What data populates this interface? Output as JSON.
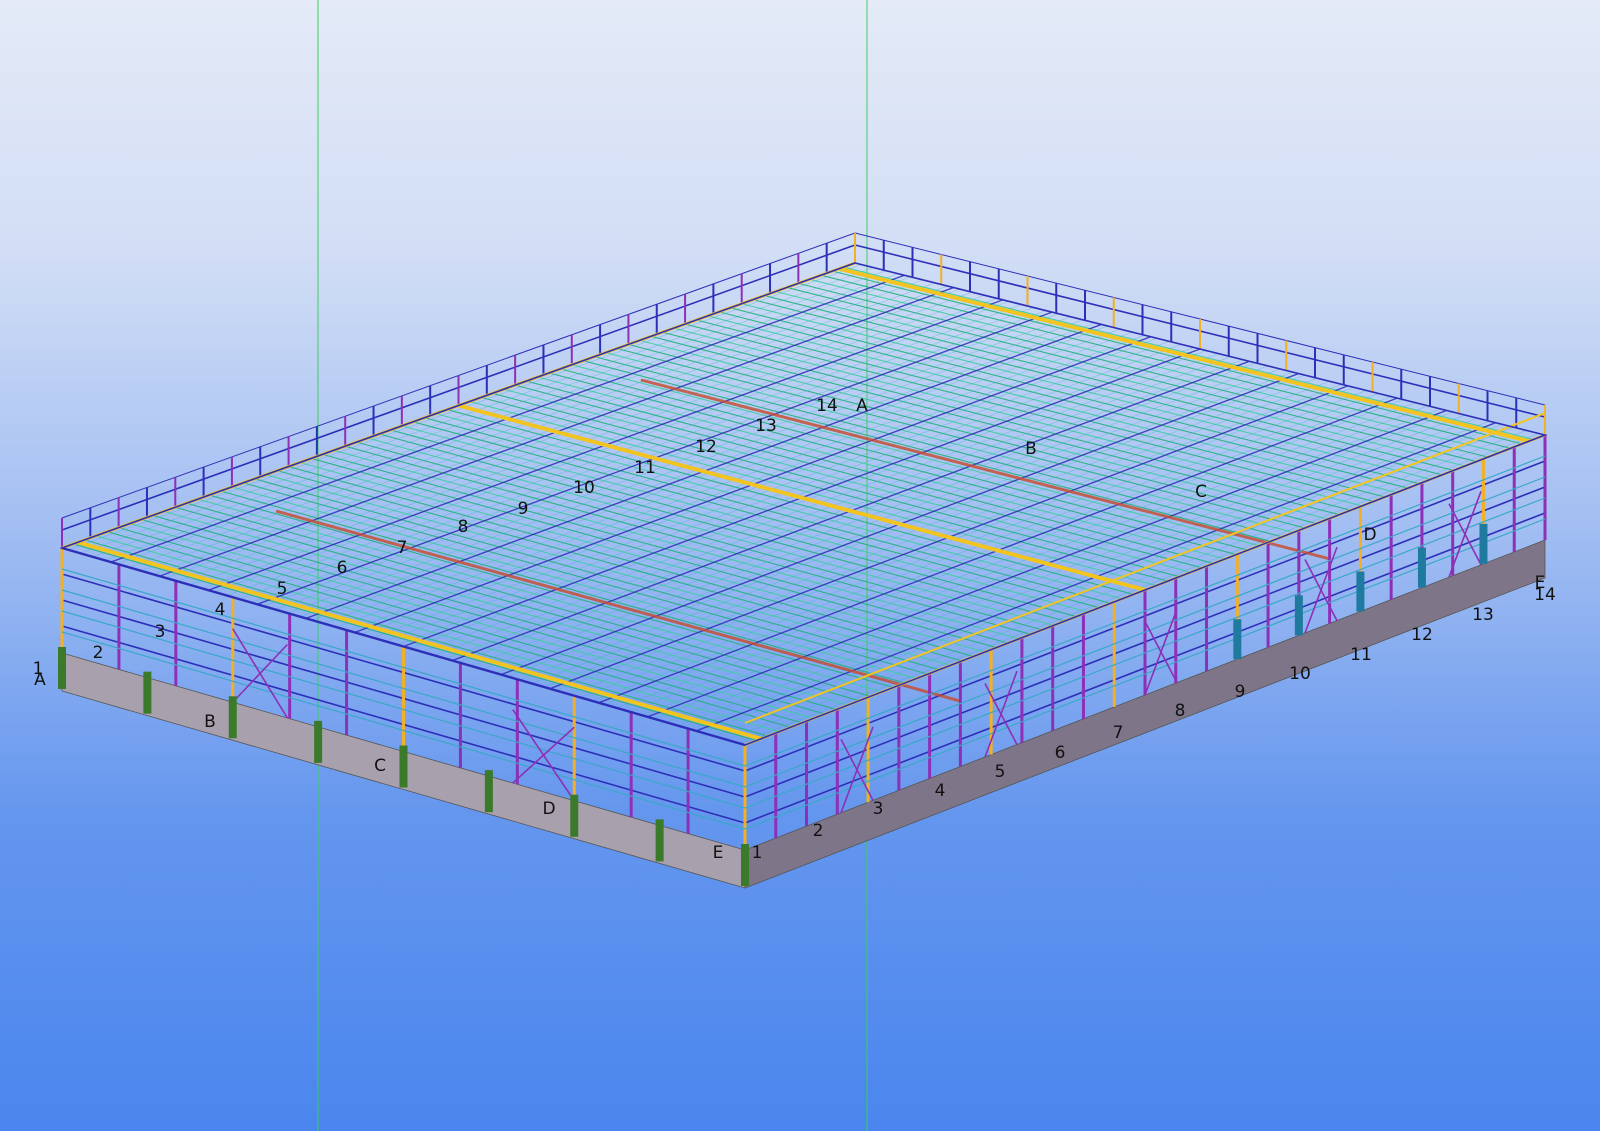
{
  "viewport": {
    "background_top": "#e4eaf7",
    "background_bottom": "#4a86ee"
  },
  "colors": {
    "column": "#8e2fb8",
    "column_alt": "#f2b024",
    "beam": "#2e2fb8",
    "purlin": "#1fb37a",
    "purlin_light": "#3fcfa0",
    "girt": "#3aa8c8",
    "yellow_beam": "#f2c420",
    "red_beam": "#c84a2a",
    "foundation": "#a8a0ac",
    "foundation_dark": "#7e7688",
    "green_column": "#3a7a2a",
    "teal_column": "#1f7aa0",
    "work_plane_line": "#39d05a"
  },
  "grid_labels": {
    "front_left_letters": [
      "A",
      "B",
      "C",
      "D",
      "E"
    ],
    "front_right_numbers": [
      "1",
      "2",
      "3",
      "4",
      "5",
      "6",
      "7",
      "8",
      "9",
      "10",
      "11",
      "12",
      "13",
      "14"
    ],
    "top_left_numbers": [
      "1",
      "2",
      "3",
      "4",
      "5",
      "6",
      "7",
      "8",
      "9",
      "10",
      "11",
      "12",
      "13",
      "14"
    ],
    "top_right_letters": [
      "A",
      "B",
      "C",
      "D",
      "E"
    ]
  }
}
